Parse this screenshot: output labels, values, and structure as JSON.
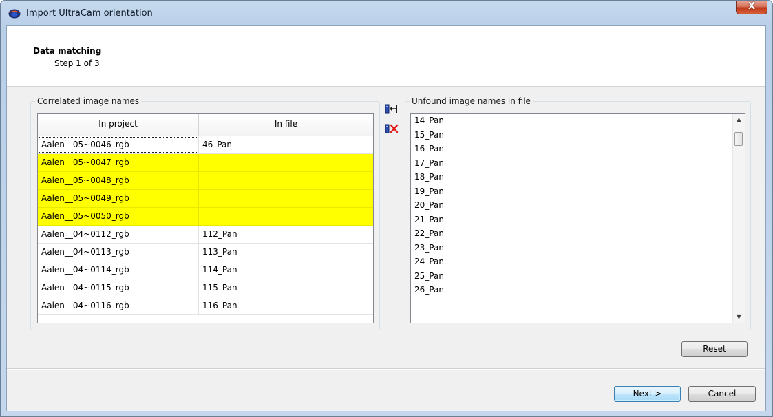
{
  "window": {
    "title": "Import UltraCam orientation",
    "close_label": "X"
  },
  "header": {
    "step_title": "Data matching",
    "step_subtitle": "Step 1 of 3"
  },
  "correlated": {
    "group_label": "Correlated image names",
    "columns": [
      "In project",
      "In file"
    ],
    "rows": [
      {
        "project": "Aalen__05~0046_rgb",
        "file": "46_Pan",
        "highlight": false
      },
      {
        "project": "Aalen__05~0047_rgb",
        "file": "",
        "highlight": true
      },
      {
        "project": "Aalen__05~0048_rgb",
        "file": "",
        "highlight": true
      },
      {
        "project": "Aalen__05~0049_rgb",
        "file": "",
        "highlight": true
      },
      {
        "project": "Aalen__05~0050_rgb",
        "file": "",
        "highlight": true
      },
      {
        "project": "Aalen__04~0112_rgb",
        "file": "112_Pan",
        "highlight": false
      },
      {
        "project": "Aalen__04~0113_rgb",
        "file": "113_Pan",
        "highlight": false
      },
      {
        "project": "Aalen__04~0114_rgb",
        "file": "114_Pan",
        "highlight": false
      },
      {
        "project": "Aalen__04~0115_rgb",
        "file": "115_Pan",
        "highlight": false
      },
      {
        "project": "Aalen__04~0116_rgb",
        "file": "116_Pan",
        "highlight": false
      }
    ],
    "highlight_color": "#ffff00"
  },
  "side_buttons": {
    "match_icon": "match-arrow-icon",
    "unmatch_icon": "unmatch-x-icon"
  },
  "unfound": {
    "group_label": "Unfound image names in file",
    "items": [
      "14_Pan",
      "15_Pan",
      "16_Pan",
      "17_Pan",
      "18_Pan",
      "19_Pan",
      "20_Pan",
      "21_Pan",
      "22_Pan",
      "23_Pan",
      "24_Pan",
      "25_Pan",
      "26_Pan"
    ]
  },
  "buttons": {
    "reset": "Reset",
    "next": "Next >",
    "cancel": "Cancel"
  }
}
